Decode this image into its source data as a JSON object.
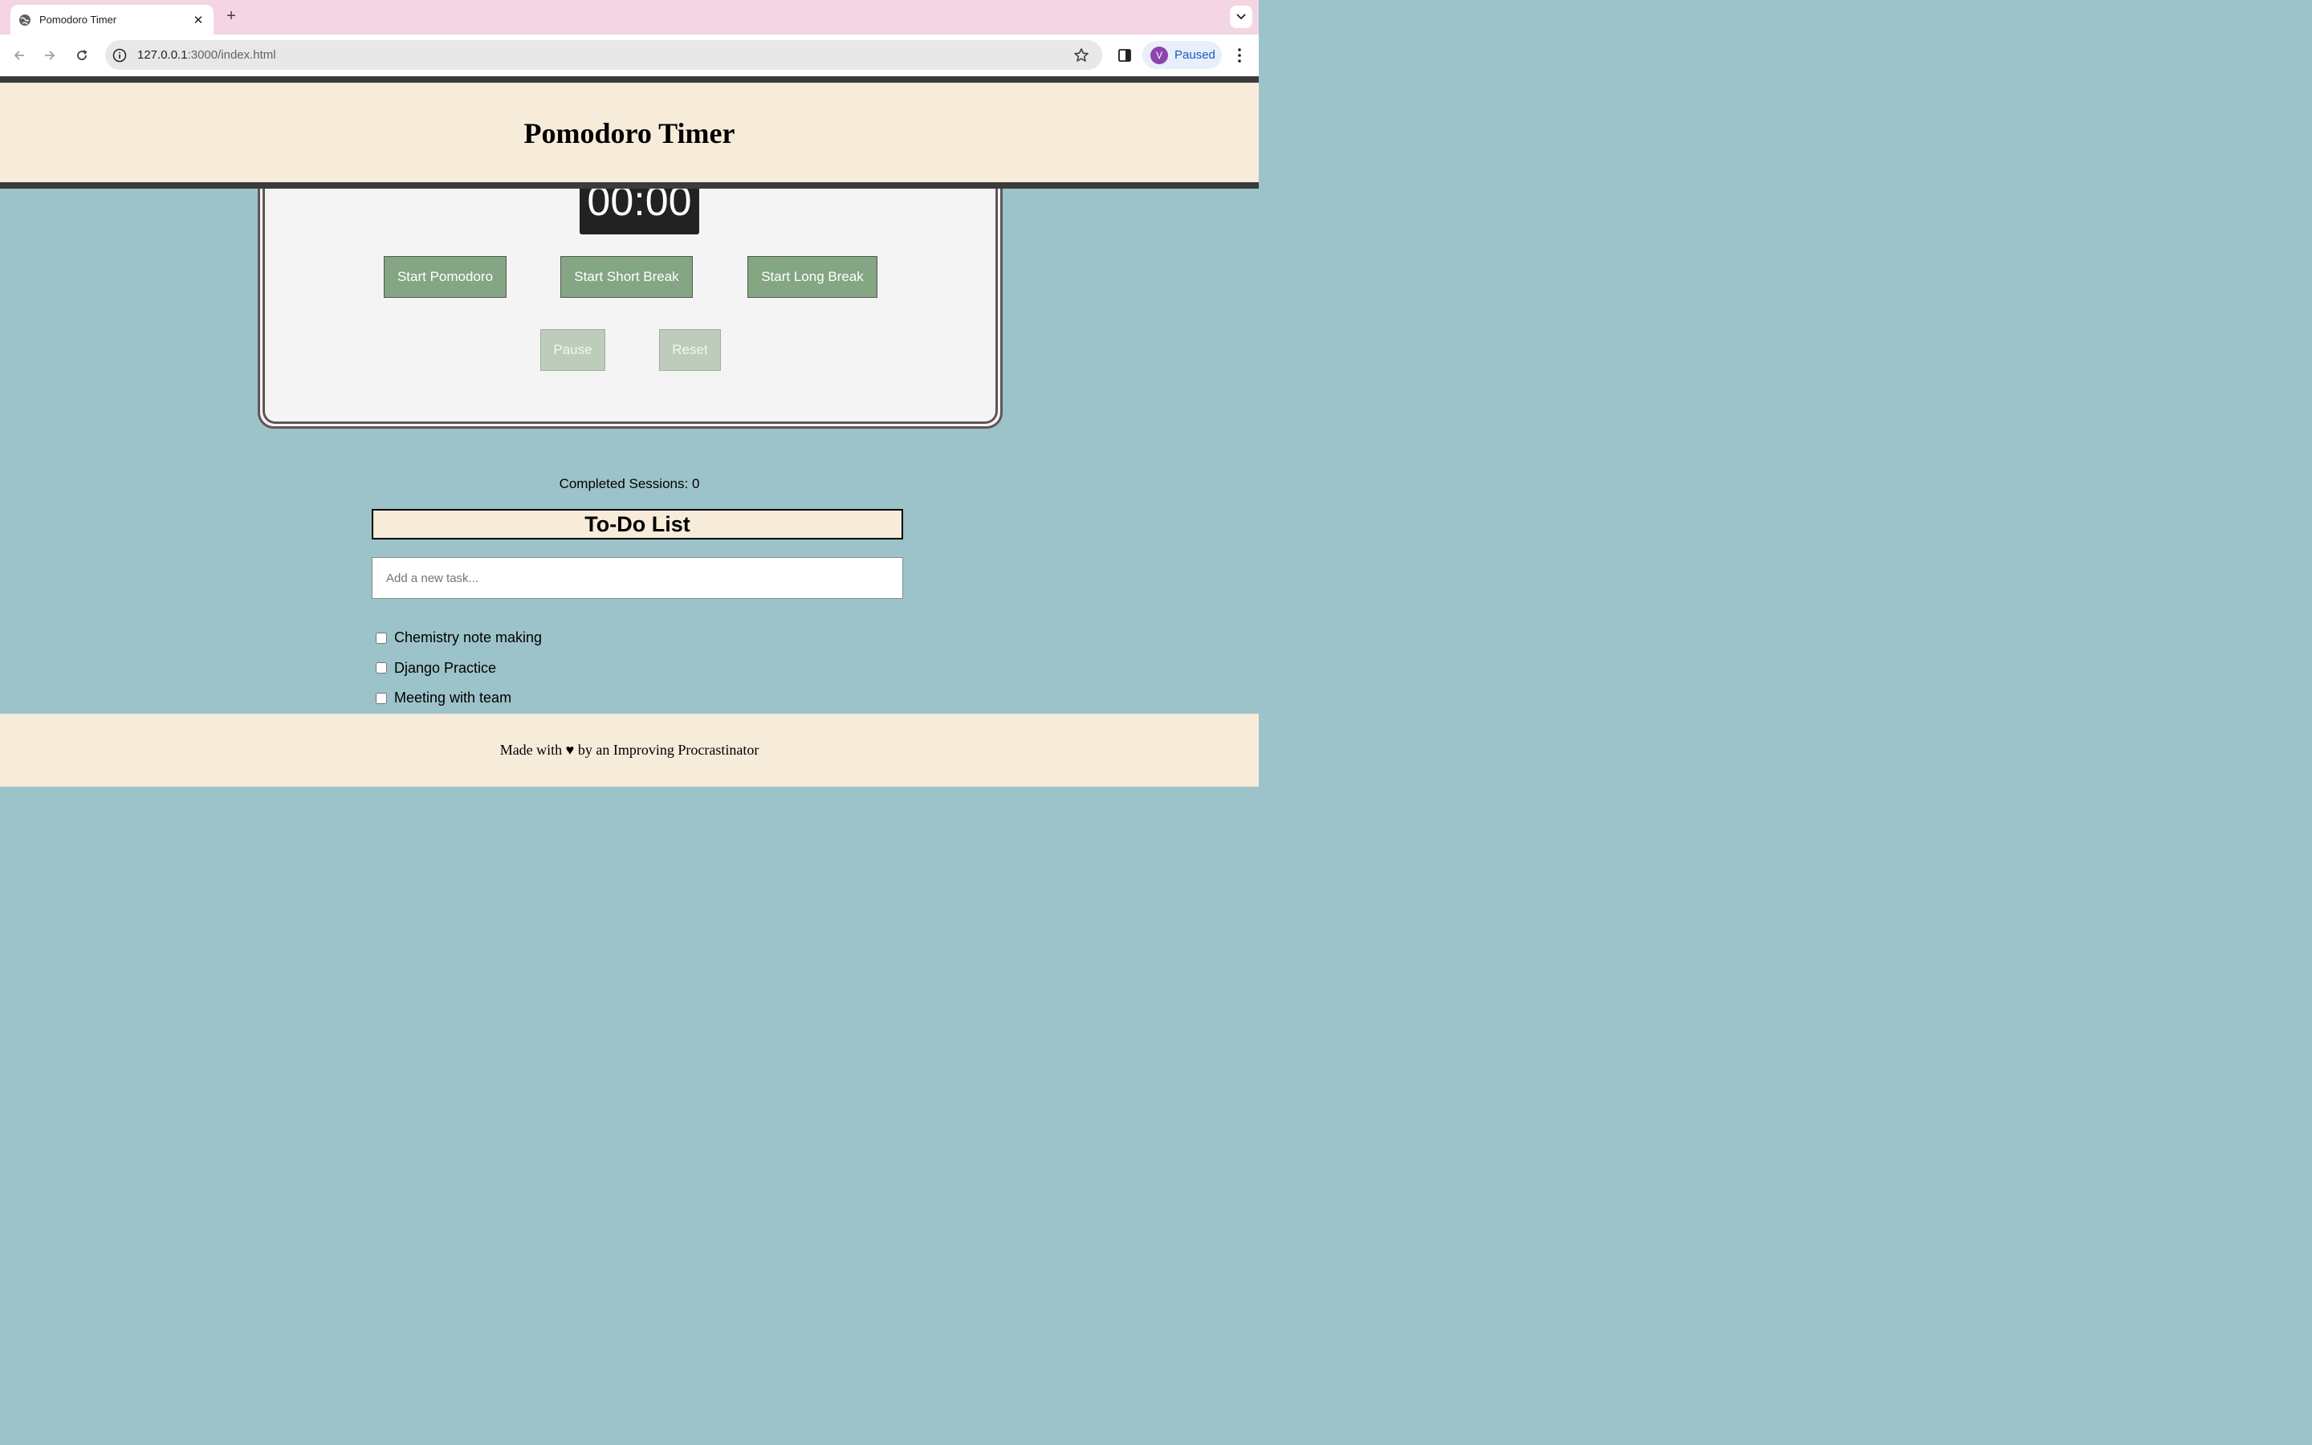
{
  "browser": {
    "tab_title": "Pomodoro Timer",
    "tab_close": "✕",
    "new_tab": "+",
    "url_host": "127.0.0.1",
    "url_path": ":3000/index.html",
    "profile_initial": "V",
    "profile_status": "Paused"
  },
  "header": {
    "title": "Pomodoro Timer"
  },
  "timer": {
    "display": "00:00",
    "buttons": {
      "start_pomodoro": "Start Pomodoro",
      "start_short_break": "Start Short Break",
      "start_long_break": "Start Long Break",
      "pause": "Pause",
      "reset": "Reset"
    }
  },
  "sessions": {
    "text": "Completed Sessions: 0"
  },
  "todo": {
    "heading": "To-Do List",
    "input_placeholder": "Add a new task...",
    "items": [
      {
        "label": "Chemistry note making",
        "checked": false
      },
      {
        "label": "Django Practice",
        "checked": false
      },
      {
        "label": "Meeting with team",
        "checked": false
      }
    ]
  },
  "footer": {
    "text": "Made with ♥ by an Improving Procrastinator"
  },
  "colors": {
    "page_bg": "#9cc3c9",
    "header_bg": "#f7ebda",
    "button_primary": "#84a683",
    "button_disabled": "#bdccbb",
    "clock_bg": "#222222"
  }
}
